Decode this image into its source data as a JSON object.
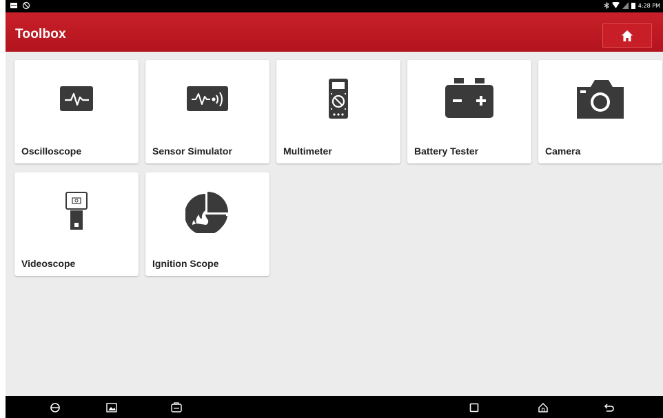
{
  "app": {
    "title": "Toolbox"
  },
  "status": {
    "time": "4:28 PM"
  },
  "colors": {
    "header": "#c8202a",
    "icon": "#3a3a3a",
    "background": "#ececec"
  },
  "tools": [
    {
      "label": "Oscilloscope",
      "icon": "oscilloscope-icon"
    },
    {
      "label": "Sensor Simulator",
      "icon": "sensor-simulator-icon"
    },
    {
      "label": "Multimeter",
      "icon": "multimeter-icon"
    },
    {
      "label": "Battery Tester",
      "icon": "battery-icon"
    },
    {
      "label": "Camera",
      "icon": "camera-icon"
    },
    {
      "label": "Videoscope",
      "icon": "videoscope-icon"
    },
    {
      "label": "Ignition Scope",
      "icon": "ignition-scope-icon"
    }
  ]
}
